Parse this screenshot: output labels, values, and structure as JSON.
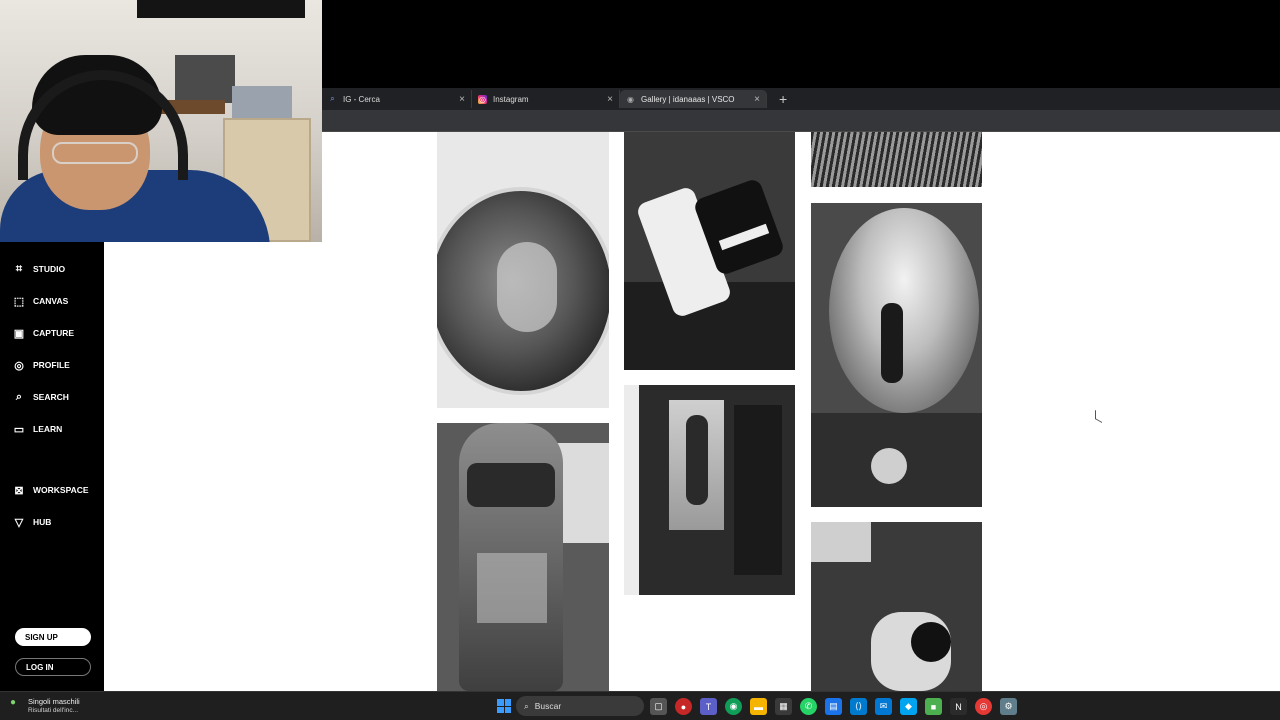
{
  "browser": {
    "tabs": [
      {
        "title": "IG - Cerca",
        "favicon": "search-favicon",
        "active": false
      },
      {
        "title": "Instagram",
        "favicon": "instagram-favicon",
        "active": false
      },
      {
        "title": "Gallery | idanaaas | VSCO",
        "favicon": "vsco-favicon",
        "active": true
      }
    ],
    "new_tab_label": "+"
  },
  "sidebar": {
    "items": [
      {
        "label": "STUDIO",
        "icon": "crop-icon"
      },
      {
        "label": "CANVAS",
        "icon": "canvas-icon"
      },
      {
        "label": "CAPTURE",
        "icon": "capture-icon"
      },
      {
        "label": "PROFILE",
        "icon": "profile-icon"
      },
      {
        "label": "SEARCH",
        "icon": "search-icon"
      },
      {
        "label": "LEARN",
        "icon": "book-icon"
      },
      {
        "label": "WORKSPACE",
        "icon": "workspace-icon"
      },
      {
        "label": "HUB",
        "icon": "hub-icon"
      }
    ],
    "signup_label": "SIGN UP",
    "login_label": "LOG IN"
  },
  "taskbar": {
    "weather_title": "Singoli maschili",
    "weather_sub": "Risultati dell'inc...",
    "search_label": "Buscar"
  },
  "colors": {
    "sidebar_bg": "#000000",
    "page_bg": "#ffffff",
    "tabbar_bg": "#202124",
    "taskbar_bg": "#1f1f1f",
    "accent": "#3b9cff"
  }
}
